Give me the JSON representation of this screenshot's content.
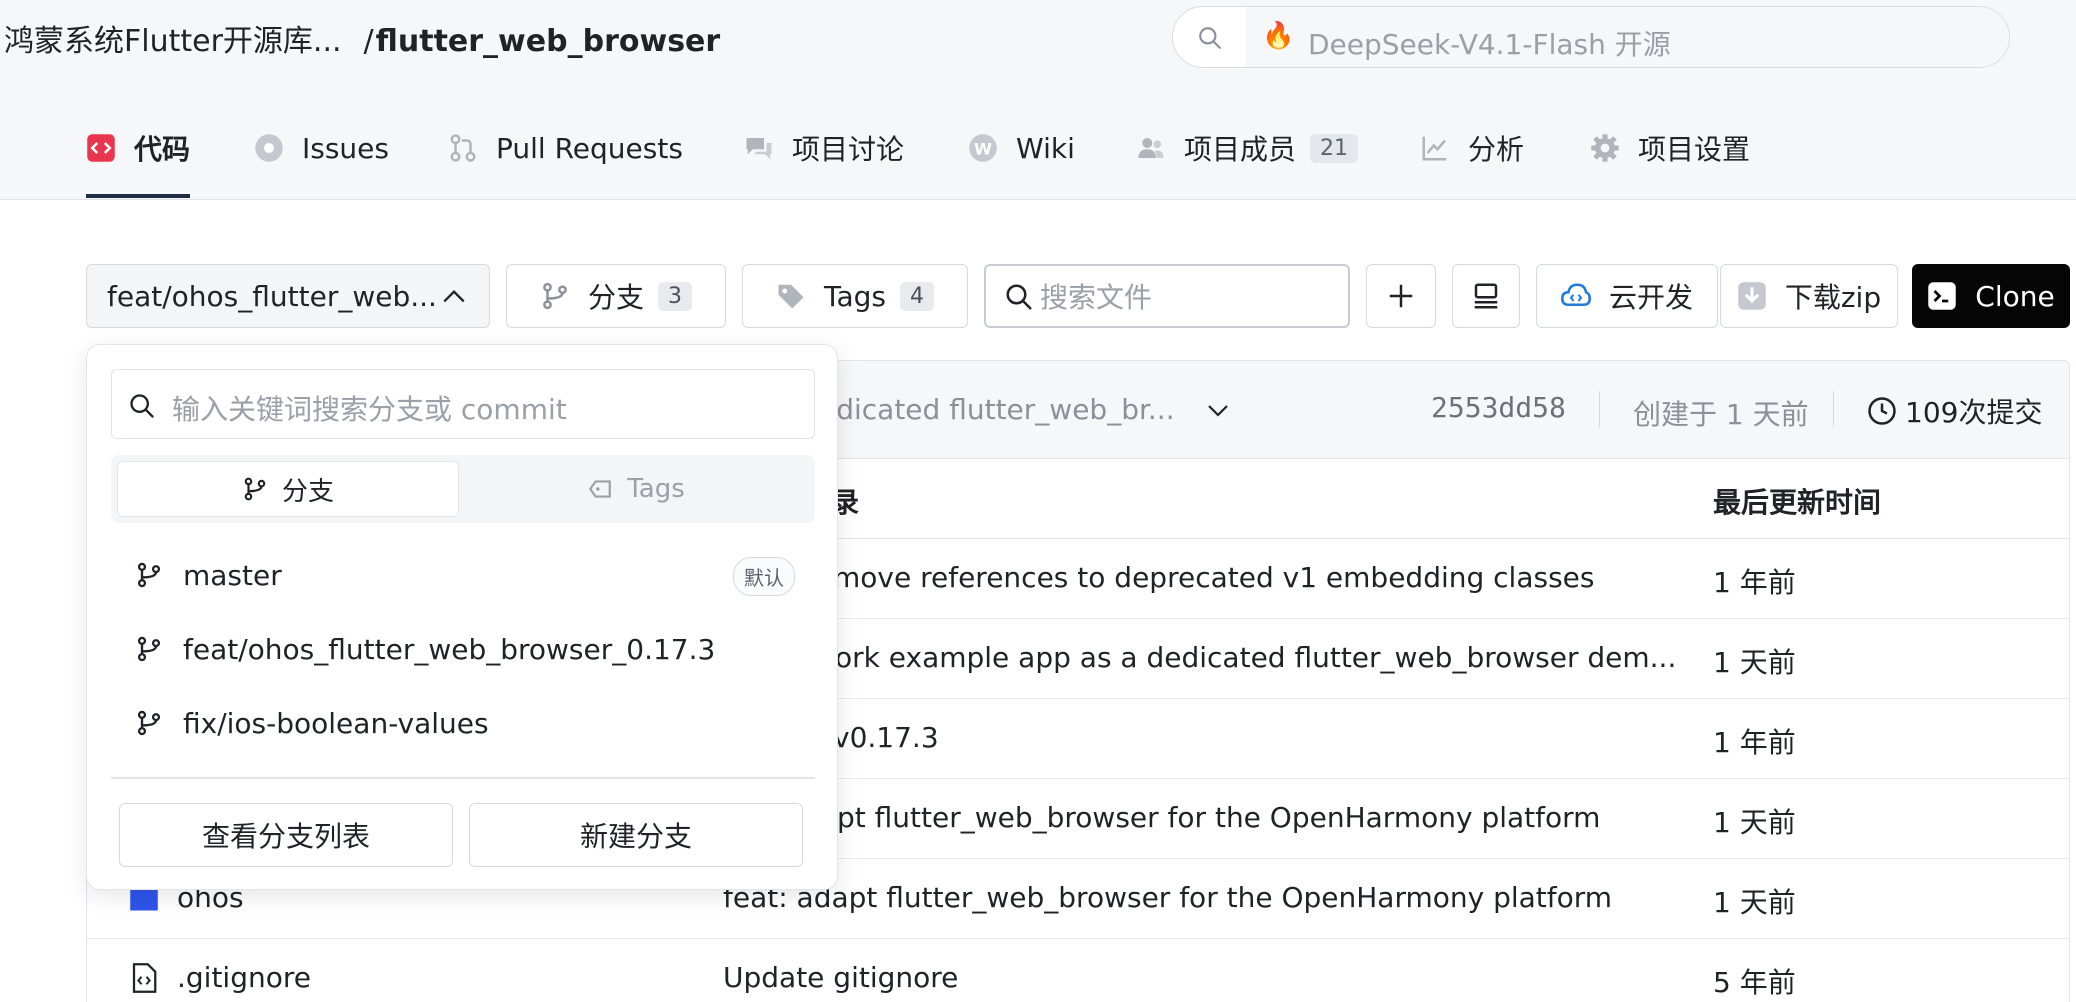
{
  "header": {
    "namespace": "鸿蒙系统Flutter开源库...",
    "separator": "/",
    "repo_name": "flutter_web_browser",
    "search_text": "DeepSeek-V4.1-Flash 开源",
    "search_icon": "search-icon",
    "fire_icon": "fire-icon"
  },
  "tabs": [
    {
      "label": "代码",
      "icon": "code-icon",
      "active": true
    },
    {
      "label": "Issues",
      "icon": "issue-icon"
    },
    {
      "label": "Pull Requests",
      "icon": "pull-request-icon"
    },
    {
      "label": "项目讨论",
      "icon": "discussion-icon"
    },
    {
      "label": "Wiki",
      "icon": "wiki-icon"
    },
    {
      "label": "项目成员",
      "icon": "members-icon",
      "count": "21"
    },
    {
      "label": "分析",
      "icon": "chart-icon"
    },
    {
      "label": "项目设置",
      "icon": "gear-icon"
    }
  ],
  "toolbar": {
    "branch_selected": "feat/ohos_flutter_web...",
    "branches_label": "分支",
    "branches_count": "3",
    "tags_label": "Tags",
    "tags_count": "4",
    "file_search_placeholder": "搜索文件",
    "cloud_label": "云开发",
    "zip_label": "下载zip",
    "clone_label": "Clone"
  },
  "commit_bar": {
    "message": "edicated flutter_web_br...",
    "hash": "2553dd58",
    "created": "创建于 1 天前",
    "commit_count": "109次提交"
  },
  "table": {
    "headers": {
      "message": "记录",
      "time": "最后更新时间"
    },
    "rows": [
      {
        "name": "",
        "message": "move references to deprecated v1 embedding classes",
        "time": "1 年前"
      },
      {
        "name": "",
        "message": "ork example app as a dedicated flutter_web_browser dem...",
        "time": "1 天前"
      },
      {
        "name": "",
        "message": "v0.17.3",
        "time": "1 年前"
      },
      {
        "name": "",
        "message": "pt flutter_web_browser for the OpenHarmony platform",
        "time": "1 天前"
      },
      {
        "name": "ohos",
        "message": "feat: adapt flutter_web_browser for the OpenHarmony platform",
        "time": "1 天前",
        "icon": "folder-icon"
      },
      {
        "name": ".gitignore",
        "message": "Update gitignore",
        "time": "5 年前",
        "icon": "file-code-icon"
      }
    ]
  },
  "dropdown": {
    "search_placeholder": "输入关键词搜索分支或 commit",
    "tab_branches": "分支",
    "tab_tags": "Tags",
    "items": [
      {
        "label": "master",
        "badge": "默认"
      },
      {
        "label": "feat/ohos_flutter_web_browser_0.17.3"
      },
      {
        "label": "fix/ios-boolean-values"
      }
    ],
    "view_list": "查看分支列表",
    "new_branch": "新建分支"
  },
  "colors": {
    "accent_red": "#e8364f",
    "clone_bg": "#050505",
    "folder_blue": "#2f54eb"
  }
}
